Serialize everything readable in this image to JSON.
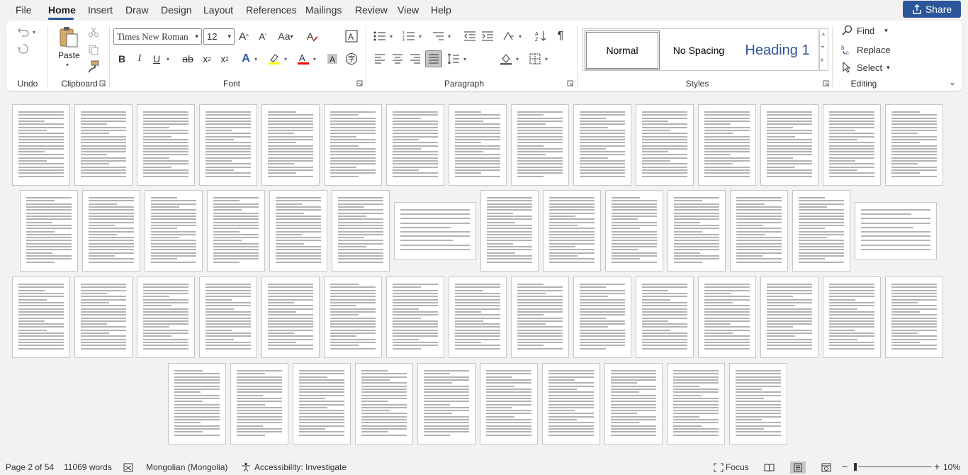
{
  "menu": {
    "tabs": [
      "File",
      "Home",
      "Insert",
      "Draw",
      "Design",
      "Layout",
      "References",
      "Mailings",
      "Review",
      "View",
      "Help"
    ],
    "active_tab": "Home",
    "share_label": "Share"
  },
  "ribbon": {
    "groups": {
      "undo": "Undo",
      "clipboard": "Clipboard",
      "font": "Font",
      "paragraph": "Paragraph",
      "styles": "Styles",
      "editing": "Editing"
    },
    "paste_label": "Paste",
    "font_name": "Times New Roman",
    "font_size": "12",
    "styles": [
      "Normal",
      "No Spacing",
      "Heading 1"
    ],
    "selected_style": "Normal",
    "editing": {
      "find": "Find",
      "replace": "Replace",
      "select": "Select"
    },
    "colors": {
      "accent": "#2b579a",
      "highlight": "#ffff00",
      "font_color": "#ff0000"
    }
  },
  "document": {
    "view": "multi-page",
    "page_count": 54
  },
  "status": {
    "page": "Page 2 of 54",
    "words": "11069 words",
    "language": "Mongolian (Mongolia)",
    "accessibility": "Accessibility: Investigate",
    "focus": "Focus",
    "zoom": "10%"
  }
}
